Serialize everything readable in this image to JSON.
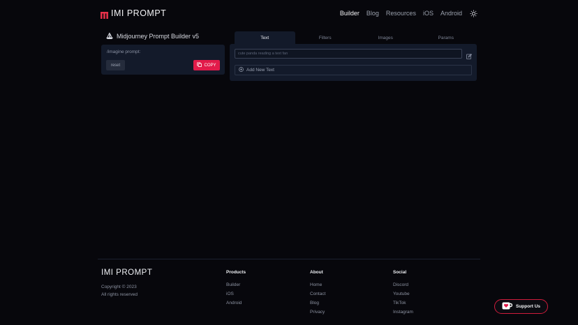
{
  "header": {
    "logo_text": "IMI PROMPT",
    "nav": [
      "Builder",
      "Blog",
      "Resources",
      "iOS",
      "Android"
    ],
    "active_nav": "Builder",
    "accent": "#e8314a"
  },
  "builder": {
    "title": "Midjourney Prompt Builder v5",
    "prompt_label": "/imagine prompt:",
    "reset_label": "reset",
    "copy_label": "COPY"
  },
  "editor": {
    "tabs": [
      "Text",
      "Filters",
      "Images",
      "Params"
    ],
    "active_tab": "Text",
    "input_placeholder": "cute panda reading a text fan",
    "add_new_label": "Add New Text"
  },
  "footer": {
    "logo_text": "IMI PROMPT",
    "copyright": "Copyright © 2023",
    "rights": "All rights reserved",
    "columns": [
      {
        "title": "Products",
        "links": [
          "Builder",
          "iOS",
          "Android"
        ]
      },
      {
        "title": "About",
        "links": [
          "Home",
          "Contact",
          "Blog",
          "Privacy"
        ]
      },
      {
        "title": "Social",
        "links": [
          "Discord",
          "Youtube",
          "TikTok",
          "Instagram"
        ]
      }
    ]
  },
  "support": {
    "label": "Support Us",
    "color": "#d01c3c"
  }
}
